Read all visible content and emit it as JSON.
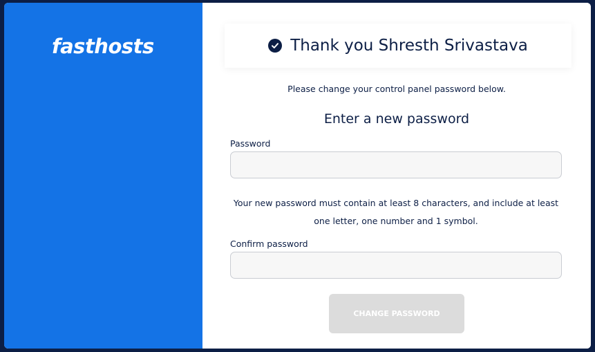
{
  "brand": {
    "logo_text": "fasthosts",
    "color": "#1473e6"
  },
  "banner": {
    "icon": "check-circle-icon",
    "message": "Thank you Shresth Srivastava"
  },
  "form": {
    "intro": "Please change your control panel password below.",
    "heading": "Enter a new password",
    "password": {
      "label": "Password",
      "value": "",
      "placeholder": ""
    },
    "requirements": "Your new password must contain at least 8 characters, and include at least one letter, one number and 1 symbol.",
    "confirm": {
      "label": "Confirm password",
      "value": "",
      "placeholder": ""
    },
    "submit_label": "CHANGE PASSWORD",
    "submit_state": "disabled"
  },
  "colors": {
    "text": "#0c1e45",
    "button_disabled": "#dcdcdc"
  }
}
